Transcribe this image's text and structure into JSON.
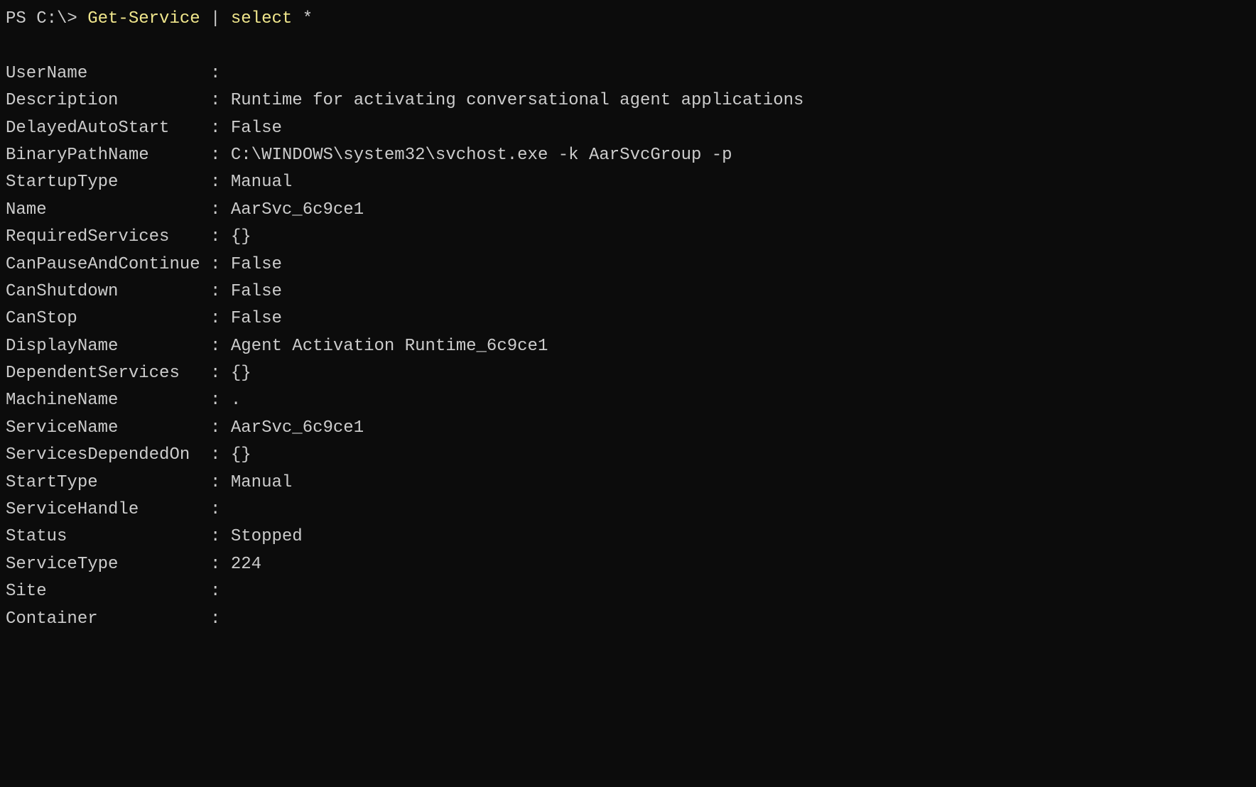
{
  "prompt": {
    "prefix": "PS C:\\> ",
    "cmdlet1": "Get-Service",
    "pipe": " | ",
    "cmdlet2": "select",
    "args": " *"
  },
  "properties": [
    {
      "name": "UserName",
      "value": ""
    },
    {
      "name": "Description",
      "value": "Runtime for activating conversational agent applications"
    },
    {
      "name": "DelayedAutoStart",
      "value": "False"
    },
    {
      "name": "BinaryPathName",
      "value": "C:\\WINDOWS\\system32\\svchost.exe -k AarSvcGroup -p"
    },
    {
      "name": "StartupType",
      "value": "Manual"
    },
    {
      "name": "Name",
      "value": "AarSvc_6c9ce1"
    },
    {
      "name": "RequiredServices",
      "value": "{}"
    },
    {
      "name": "CanPauseAndContinue",
      "value": "False"
    },
    {
      "name": "CanShutdown",
      "value": "False"
    },
    {
      "name": "CanStop",
      "value": "False"
    },
    {
      "name": "DisplayName",
      "value": "Agent Activation Runtime_6c9ce1"
    },
    {
      "name": "DependentServices",
      "value": "{}"
    },
    {
      "name": "MachineName",
      "value": "."
    },
    {
      "name": "ServiceName",
      "value": "AarSvc_6c9ce1"
    },
    {
      "name": "ServicesDependedOn",
      "value": "{}"
    },
    {
      "name": "StartType",
      "value": "Manual"
    },
    {
      "name": "ServiceHandle",
      "value": ""
    },
    {
      "name": "Status",
      "value": "Stopped"
    },
    {
      "name": "ServiceType",
      "value": "224"
    },
    {
      "name": "Site",
      "value": ""
    },
    {
      "name": "Container",
      "value": ""
    }
  ],
  "nameWidth": 19
}
